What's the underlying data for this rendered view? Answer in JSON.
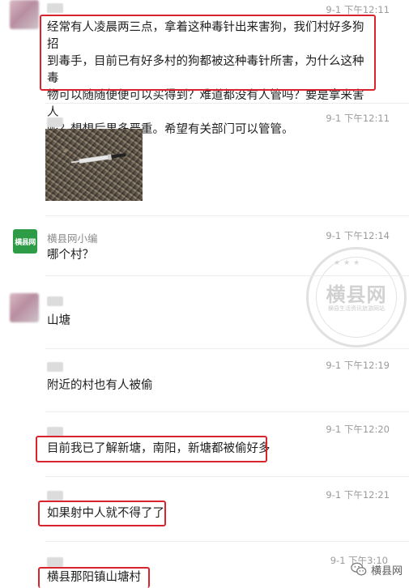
{
  "messages": [
    {
      "id": "m1",
      "time": "9-1 下午12:11",
      "text": "经常有人凌晨两三点，拿着这种毒针出来害狗，我们村好多狗招到毒手，目前已有好多村的狗都被这种毒针所害，为什么这种毒物可以随随便便可以买得到？难道都没有人管吗？要是拿来害人呢？想想后果多严重。希望有关部门可以管管。",
      "lines": [
        "经常有人凌晨两三点，拿着这种毒针出来害狗，我们村好多狗招",
        "到毒手，目前已有好多村的狗都被这种毒针所害，为什么这种毒",
        "物可以随随便便可以买得到？难道都没有人管吗？要是拿来害人",
        "呢？想想后果多严重。希望有关部门可以管管。"
      ]
    },
    {
      "id": "m2",
      "time": "9-1 下午12:11",
      "image": "photo of syringe on gravel"
    },
    {
      "id": "m3",
      "name": "横县网小编",
      "avatar_text": "横县网",
      "time": "9-1 下午12:14",
      "text": "哪个村？"
    },
    {
      "id": "m4",
      "time": "9-1 下午12:17",
      "text": "山塘"
    },
    {
      "id": "m5",
      "time": "9-1 下午12:19",
      "text": "附近的村也有人被偷"
    },
    {
      "id": "m6",
      "time": "9-1 下午12:20",
      "text": "目前我已了解新塘，南阳，新塘都被偷好多"
    },
    {
      "id": "m7",
      "time": "9-1 下午12:21",
      "text": "如果射中人就不得了了"
    },
    {
      "id": "m8",
      "time": "9-1 下午3:10",
      "text": "横县那阳镇山塘村"
    }
  ],
  "watermark": {
    "title": "横县网",
    "sub": "横县生活资讯旅游网站",
    "sub2": "HENGXIAN"
  },
  "brand": {
    "label": "横县网",
    "icon": "wechat-icon"
  },
  "colors": {
    "highlight": "#d9232d",
    "logo_green": "#2e9b46"
  }
}
